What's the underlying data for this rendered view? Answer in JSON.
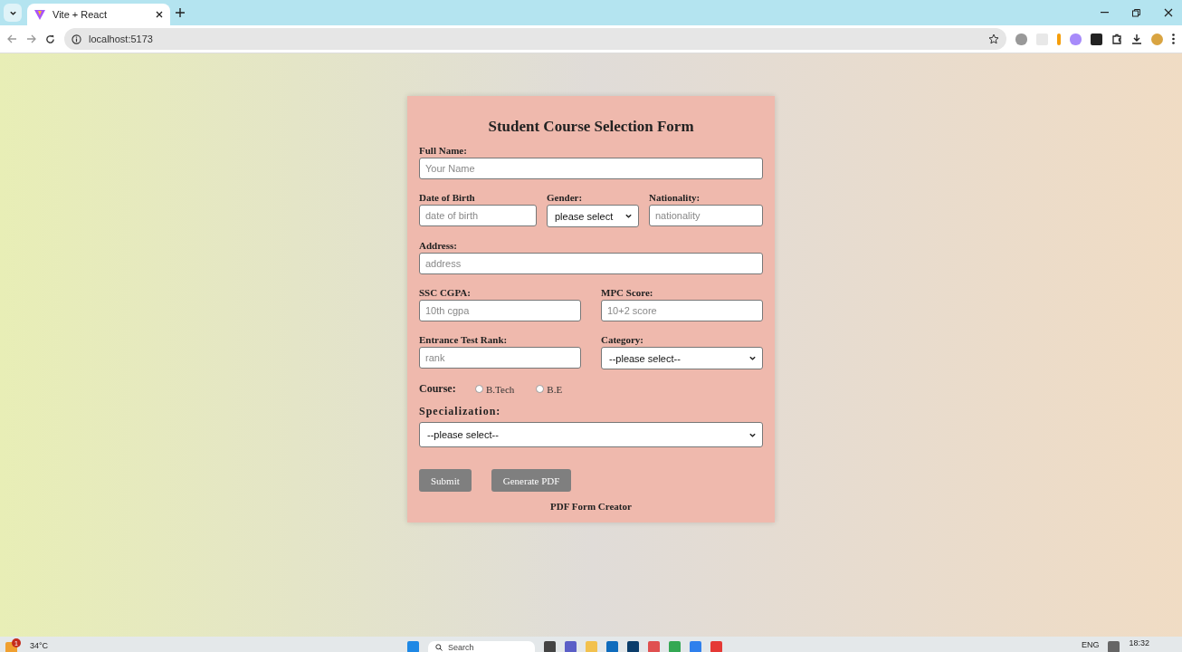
{
  "browser": {
    "tab_title": "Vite + React",
    "address": "localhost:5173"
  },
  "form": {
    "title": "Student Course Selection Form",
    "full_name": {
      "label": "Full Name:",
      "placeholder": "Your Name"
    },
    "row1": [
      {
        "kind": "input",
        "label": "Date of Birth",
        "placeholder": "date of birth"
      },
      {
        "kind": "select",
        "label": "Gender:",
        "value": "please select"
      },
      {
        "kind": "input",
        "label": "Nationality:",
        "placeholder": "nationality"
      }
    ],
    "address": {
      "label": "Address:",
      "placeholder": "address"
    },
    "row2": [
      {
        "kind": "input",
        "label": "SSC CGPA:",
        "placeholder": "10th cgpa"
      },
      {
        "kind": "input",
        "label": "MPC Score:",
        "placeholder": "10+2 score"
      }
    ],
    "row3": [
      {
        "kind": "input",
        "label": "Entrance Test Rank:",
        "placeholder": "rank"
      },
      {
        "kind": "select",
        "label": "Category:",
        "value": "--please select--"
      }
    ],
    "course": {
      "label": "Course:",
      "options": [
        {
          "label": "B.Tech",
          "selected": false
        },
        {
          "label": "B.E",
          "selected": false
        }
      ]
    },
    "specialization": {
      "label": "Specialization:",
      "value": "--please select--"
    },
    "buttons": [
      "Submit",
      "Generate PDF"
    ],
    "footer": "PDF Form Creator"
  },
  "taskbar": {
    "weather": "34°C",
    "badge": "1",
    "search": "Search",
    "language": "ENG",
    "time": "18:32"
  }
}
